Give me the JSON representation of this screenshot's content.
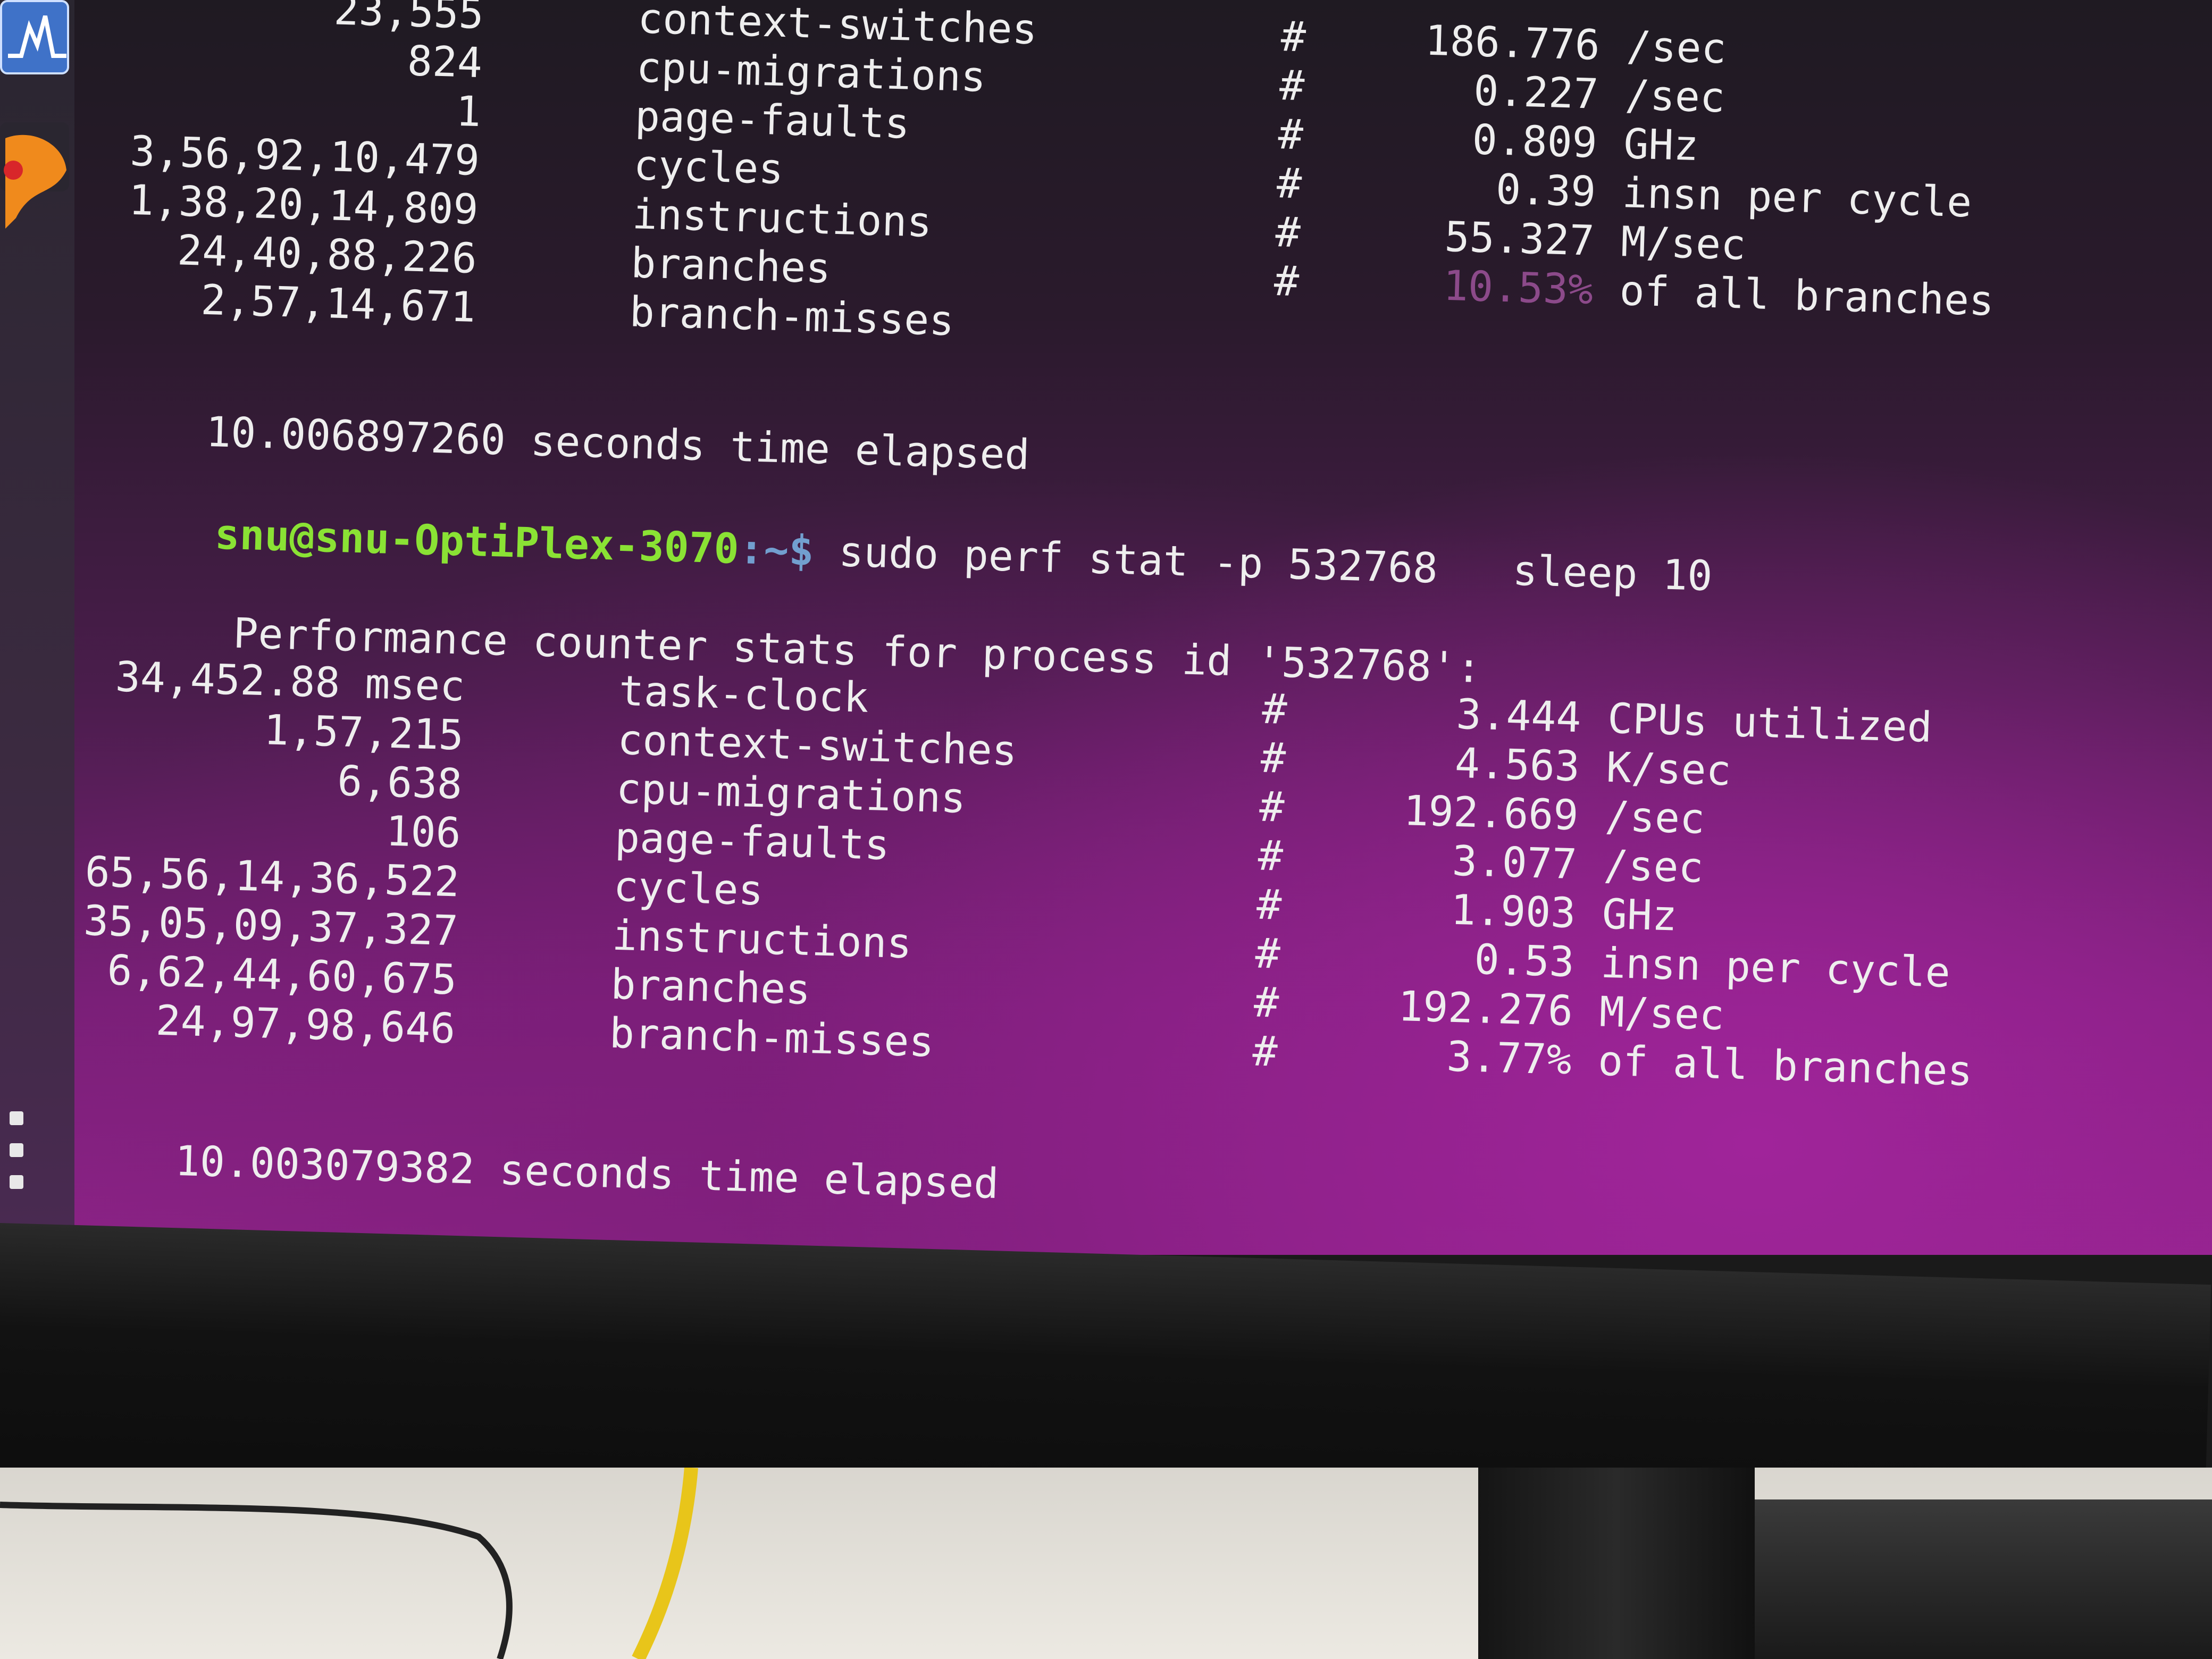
{
  "prev_run": {
    "stats": [
      {
        "count": "23,555",
        "event": "context-switches",
        "value": "186.776",
        "unit": "/sec"
      },
      {
        "count": "824",
        "event": "cpu-migrations",
        "value": "0.227",
        "unit": "/sec"
      },
      {
        "count": "1",
        "event": "page-faults",
        "value": "0.809",
        "unit": "GHz"
      },
      {
        "count": "3,56,92,10,479",
        "event": "cycles",
        "value": "0.39",
        "unit": "insn per cycle"
      },
      {
        "count": "1,38,20,14,809",
        "event": "instructions",
        "value": "55.327",
        "unit": "M/sec"
      },
      {
        "count": "24,40,88,226",
        "event": "branches",
        "value": "10.53%",
        "unit": "of all branches"
      },
      {
        "count": "2,57,14,671",
        "event": "branch-misses",
        "value": "",
        "unit": ""
      }
    ],
    "elapsed": "10.006897260 seconds time elapsed"
  },
  "prompt": {
    "user_host": "snu@snu-OptiPlex-3070",
    "path": ":~$"
  },
  "command": "sudo perf stat -p 532768   sleep 10",
  "header": "Performance counter stats for process id '532768':",
  "stats": [
    {
      "count": "34,452.88 msec",
      "event": "task-clock",
      "value": "3.444",
      "unit": "CPUs utilized"
    },
    {
      "count": "1,57,215",
      "event": "context-switches",
      "value": "4.563",
      "unit": "K/sec"
    },
    {
      "count": "6,638",
      "event": "cpu-migrations",
      "value": "192.669",
      "unit": "/sec"
    },
    {
      "count": "106",
      "event": "page-faults",
      "value": "3.077",
      "unit": "/sec"
    },
    {
      "count": "65,56,14,36,522",
      "event": "cycles",
      "value": "1.903",
      "unit": "GHz"
    },
    {
      "count": "35,05,09,37,327",
      "event": "instructions",
      "value": "0.53",
      "unit": "insn per cycle"
    },
    {
      "count": "6,62,44,60,675",
      "event": "branches",
      "value": "192.276",
      "unit": "M/sec"
    },
    {
      "count": "24,97,98,646",
      "event": "branch-misses",
      "value": "3.77%",
      "unit": "of all branches"
    }
  ],
  "elapsed": "10.003079382 seconds time elapsed",
  "hash": "#",
  "icons": [
    "system-monitor-icon",
    "vlc-icon",
    "app-grid-icon",
    "terminal-cursor"
  ]
}
